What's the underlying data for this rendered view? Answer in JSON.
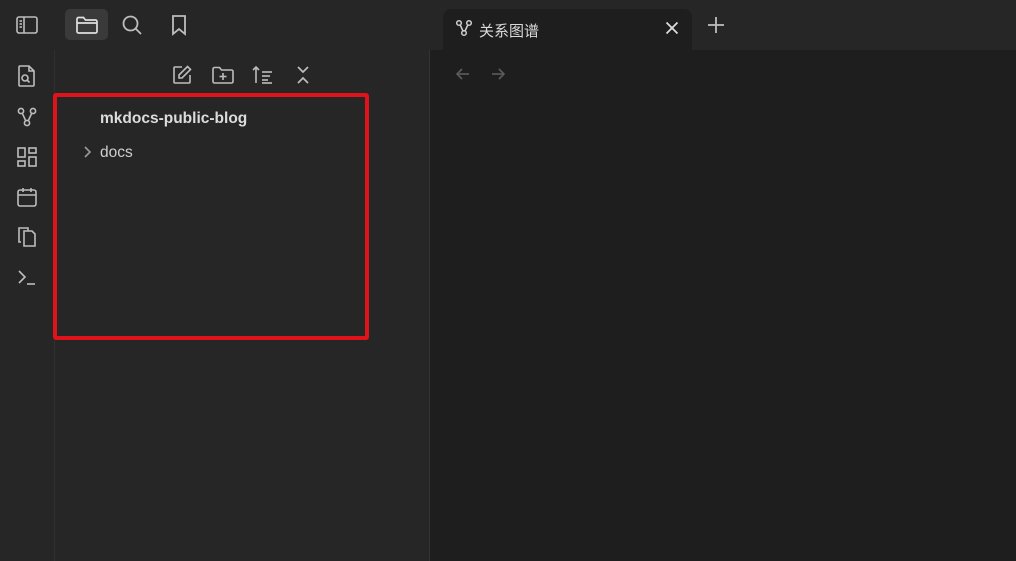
{
  "tabs": [
    {
      "label": "关系图谱",
      "icon": "graph-icon"
    }
  ],
  "top_buttons": {
    "sidebar_toggle": "sidebar-toggle-icon",
    "files": "folder-icon",
    "search": "search-icon",
    "bookmarks": "bookmark-icon",
    "new_tab": "plus-icon",
    "close_tab": "close-icon"
  },
  "ribbon": [
    "file-search-icon",
    "graph-icon",
    "dashboard-icon",
    "calendar-icon",
    "copy-icon",
    "terminal-icon"
  ],
  "sidebar_toolbar": [
    "new-note-icon",
    "new-folder-icon",
    "sort-icon",
    "collapse-all-icon"
  ],
  "file_tree": {
    "root": "mkdocs-public-blog",
    "items": [
      {
        "label": "docs",
        "type": "folder",
        "expanded": false
      }
    ]
  },
  "navigation": {
    "back": "arrow-left-icon",
    "forward": "arrow-right-icon"
  },
  "colors": {
    "background": "#1e1e1e",
    "panel": "#262626",
    "highlight": "#e0121a",
    "text": "#dadada"
  }
}
